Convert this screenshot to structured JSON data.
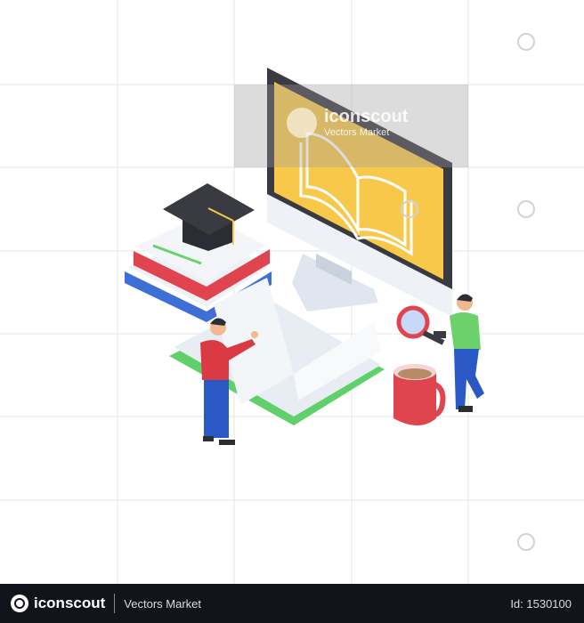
{
  "watermark": {
    "brand": "iconscout",
    "subtitle": "Vectors Market"
  },
  "footer": {
    "brand": "iconscout",
    "subtitle": "Vectors Market",
    "id_label": "Id: 1530100"
  },
  "colors": {
    "screen": "#f7c84a",
    "monitor_frame": "#3a3a42",
    "book_red": "#e0454f",
    "book_blue": "#3d6fd6",
    "book_green_edge": "#5fd06a",
    "shirt_red": "#d93a44",
    "shirt_green": "#6bd16a",
    "pants_blue": "#2a58c4",
    "footer_bg": "#12141c"
  }
}
